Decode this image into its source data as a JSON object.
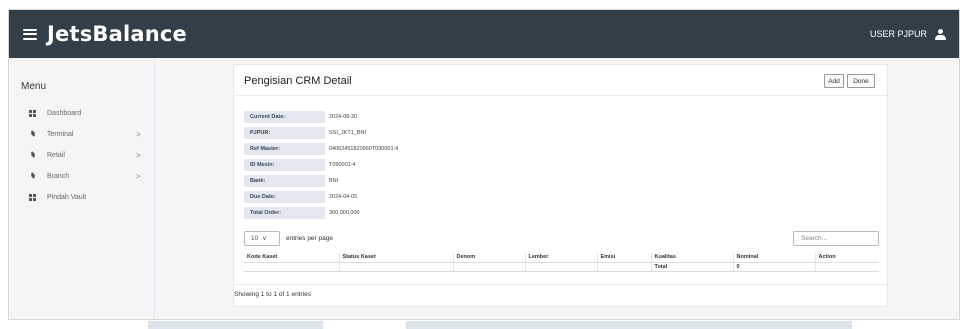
{
  "header": {
    "app_name": "JetsBalance",
    "user_label": "USER PJPUR"
  },
  "sidebar": {
    "menu_title": "Menu",
    "items": [
      {
        "label": "Dashboard",
        "icon": "grid-icon",
        "has_submenu": false
      },
      {
        "label": "Terminal",
        "icon": "layers-icon",
        "has_submenu": true
      },
      {
        "label": "Retail",
        "icon": "layers-icon",
        "has_submenu": true
      },
      {
        "label": "Branch",
        "icon": "layers-icon",
        "has_submenu": true
      },
      {
        "label": "Pindah Vault",
        "icon": "grid-icon",
        "has_submenu": false
      }
    ],
    "chevron": ">"
  },
  "page": {
    "title": "Pengisian CRM Detail",
    "add_label": "Add",
    "done_label": "Done"
  },
  "details": [
    {
      "label": "Current Date:",
      "value": "2024-08-30"
    },
    {
      "label": "PJPUR:",
      "value": "SSI_JKT1_BNI"
    },
    {
      "label": "Ref Master:",
      "value": "04062451820960T090001:4"
    },
    {
      "label": "ID Mesin:",
      "value": "T090001:4"
    },
    {
      "label": "Bank:",
      "value": "BNI"
    },
    {
      "label": "Due Date:",
      "value": "2024-04-05"
    },
    {
      "label": "Total Order:",
      "value": "300,000,000"
    }
  ],
  "table_controls": {
    "page_length": "10",
    "entries_label": "entries per page",
    "search_placeholder": "Search..."
  },
  "table": {
    "columns": [
      "Kode Kaset",
      "Status Kaset",
      "Denom",
      "Lember",
      "Emisi",
      "Kualitas",
      "Nominal",
      "Action"
    ],
    "total_label": "Total",
    "total_value": "0"
  },
  "footer": {
    "showing_text": "Showing 1 to 1 of 1 entries"
  },
  "colors": {
    "topbar": "#333f48",
    "sidebar_bg": "#f4f5f7",
    "label_cell_bg": "#e4e8ee"
  }
}
